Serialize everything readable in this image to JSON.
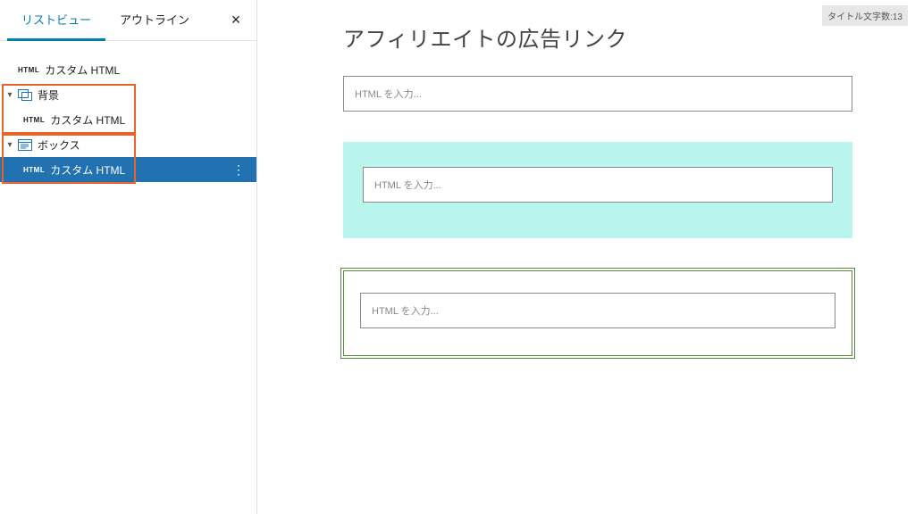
{
  "sidebar": {
    "tabs": {
      "list_view": "リストビュー",
      "outline": "アウトライン"
    },
    "tree": {
      "item0": {
        "badge": "HTML",
        "label": "カスタム HTML"
      },
      "item1": {
        "label": "背景",
        "child": {
          "badge": "HTML",
          "label": "カスタム HTML"
        }
      },
      "item2": {
        "label": "ボックス",
        "child": {
          "badge": "HTML",
          "label": "カスタム HTML"
        }
      }
    }
  },
  "editor": {
    "char_count": "タイトル文字数:13",
    "title": "アフィリエイトの広告リンク",
    "html_placeholder": "HTML を入力..."
  },
  "colors": {
    "selected_row": "#2271b1",
    "highlight_border": "#e8622c",
    "bg_block": "#b9f5ed",
    "box_border": "#5a8a3b"
  }
}
